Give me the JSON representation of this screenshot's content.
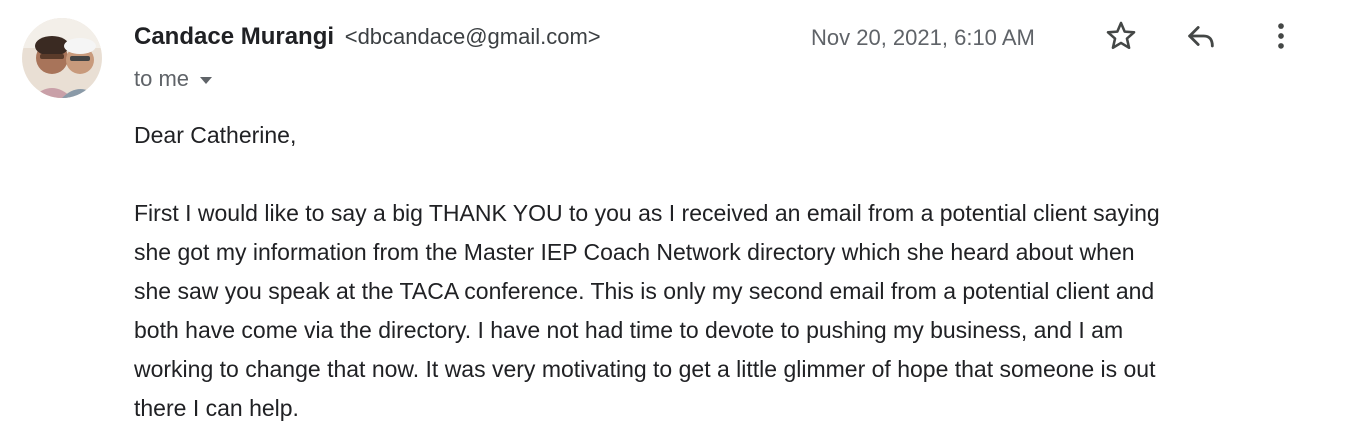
{
  "sender": {
    "name": "Candace Murangi",
    "email": "<dbcandace@gmail.com>"
  },
  "recipient": {
    "label": "to me"
  },
  "date": "Nov 20, 2021, 6:10 AM",
  "icons": {
    "avatar": "avatar-photo",
    "star": "star-icon",
    "reply": "reply-icon",
    "more": "more-vert-icon",
    "caret": "caret-down-icon"
  },
  "colors": {
    "text": "#202124",
    "secondary": "#5f6368",
    "icon": "#444746"
  },
  "body": {
    "greeting": "Dear Catherine,",
    "paragraph_lines": [
      "First I would like to say a big THANK YOU to you as I received an email from a potential client saying",
      "she got my information from the Master IEP Coach Network directory which she heard about when",
      "she saw you speak at the TACA conference.  This is only my second email from a potential client and",
      "both have come via the directory.  I have not had time to devote to pushing my business, and I am",
      "working to change that now.  It was very motivating to get a little glimmer of hope that someone is out",
      "there I can help."
    ]
  }
}
